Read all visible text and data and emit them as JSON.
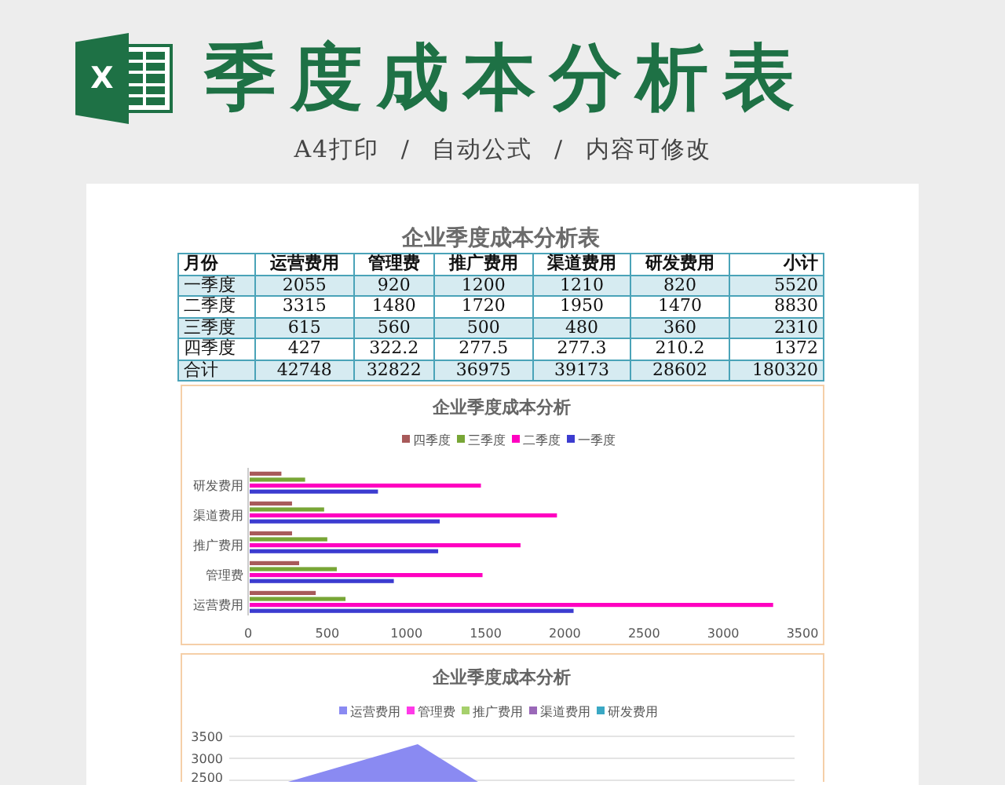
{
  "header": {
    "logo_letter": "X",
    "title": "季度成本分析表",
    "subtitle": "A4打印 / 自动公式 / 内容可修改"
  },
  "table": {
    "title": "企业季度成本分析表",
    "columns": [
      "月份",
      "运营费用",
      "管理费",
      "推广费用",
      "渠道费用",
      "研发费用",
      "小计"
    ],
    "rows": [
      [
        "一季度",
        "2055",
        "920",
        "1200",
        "1210",
        "820",
        "5520"
      ],
      [
        "二季度",
        "3315",
        "1480",
        "1720",
        "1950",
        "1470",
        "8830"
      ],
      [
        "三季度",
        "615",
        "560",
        "500",
        "480",
        "360",
        "2310"
      ],
      [
        "四季度",
        "427",
        "322.2",
        "277.5",
        "277.3",
        "210.2",
        "1372"
      ],
      [
        "合计",
        "42748",
        "32822",
        "36975",
        "39173",
        "28602",
        "180320"
      ]
    ]
  },
  "bar_chart": {
    "chart_data": {
      "type": "bar",
      "orientation": "horizontal",
      "legend": "top",
      "title": "企业季度成本分析",
      "categories": [
        "研发费用",
        "渠道费用",
        "推广费用",
        "管理费",
        "运营费用"
      ],
      "series": [
        {
          "name": "一季度",
          "color": "#3c3cd0",
          "values": [
            820,
            1210,
            1200,
            920,
            2055
          ]
        },
        {
          "name": "二季度",
          "color": "#ff00c0",
          "values": [
            1470,
            1950,
            1720,
            1480,
            3315
          ]
        },
        {
          "name": "三季度",
          "color": "#78a636",
          "values": [
            360,
            480,
            500,
            560,
            615
          ]
        },
        {
          "name": "四季度",
          "color": "#a85a5a",
          "values": [
            210.2,
            277.3,
            277.5,
            322.2,
            427
          ]
        }
      ],
      "xlim": [
        0,
        3500
      ],
      "xticks": [
        0,
        500,
        1000,
        1500,
        2000,
        2500,
        3000,
        3500
      ]
    }
  },
  "area_chart": {
    "title": "企业季度成本分析",
    "legend": [
      {
        "name": "运营费用",
        "color": "#8a8af2"
      },
      {
        "name": "管理费",
        "color": "#ff3ae8"
      },
      {
        "name": "推广费用",
        "color": "#a6d06c"
      },
      {
        "name": "渠道费用",
        "color": "#9a68b8"
      },
      {
        "name": "研发费用",
        "color": "#3aa8c4"
      }
    ],
    "y_axis_labels": [
      "3500",
      "3000",
      "2500"
    ]
  }
}
